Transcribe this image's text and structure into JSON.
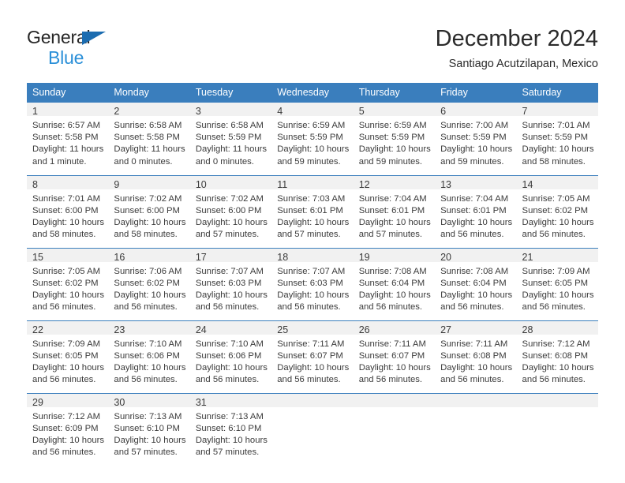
{
  "brand": {
    "word1": "General",
    "word2": "Blue",
    "triangle_color": "#1b6cb0",
    "word2_color": "#2a8fd8"
  },
  "header": {
    "title": "December 2024",
    "subtitle": "Santiago Acutzilapan, Mexico"
  },
  "theme": {
    "header_blue": "#3a7ebd",
    "daynum_band": "#f1f1f1",
    "text": "#3b3b3b"
  },
  "weekday_headers": [
    "Sunday",
    "Monday",
    "Tuesday",
    "Wednesday",
    "Thursday",
    "Friday",
    "Saturday"
  ],
  "weeks": [
    [
      {
        "day": "1",
        "sunrise": "Sunrise: 6:57 AM",
        "sunset": "Sunset: 5:58 PM",
        "daylight1": "Daylight: 11 hours",
        "daylight2": "and 1 minute."
      },
      {
        "day": "2",
        "sunrise": "Sunrise: 6:58 AM",
        "sunset": "Sunset: 5:58 PM",
        "daylight1": "Daylight: 11 hours",
        "daylight2": "and 0 minutes."
      },
      {
        "day": "3",
        "sunrise": "Sunrise: 6:58 AM",
        "sunset": "Sunset: 5:59 PM",
        "daylight1": "Daylight: 11 hours",
        "daylight2": "and 0 minutes."
      },
      {
        "day": "4",
        "sunrise": "Sunrise: 6:59 AM",
        "sunset": "Sunset: 5:59 PM",
        "daylight1": "Daylight: 10 hours",
        "daylight2": "and 59 minutes."
      },
      {
        "day": "5",
        "sunrise": "Sunrise: 6:59 AM",
        "sunset": "Sunset: 5:59 PM",
        "daylight1": "Daylight: 10 hours",
        "daylight2": "and 59 minutes."
      },
      {
        "day": "6",
        "sunrise": "Sunrise: 7:00 AM",
        "sunset": "Sunset: 5:59 PM",
        "daylight1": "Daylight: 10 hours",
        "daylight2": "and 59 minutes."
      },
      {
        "day": "7",
        "sunrise": "Sunrise: 7:01 AM",
        "sunset": "Sunset: 5:59 PM",
        "daylight1": "Daylight: 10 hours",
        "daylight2": "and 58 minutes."
      }
    ],
    [
      {
        "day": "8",
        "sunrise": "Sunrise: 7:01 AM",
        "sunset": "Sunset: 6:00 PM",
        "daylight1": "Daylight: 10 hours",
        "daylight2": "and 58 minutes."
      },
      {
        "day": "9",
        "sunrise": "Sunrise: 7:02 AM",
        "sunset": "Sunset: 6:00 PM",
        "daylight1": "Daylight: 10 hours",
        "daylight2": "and 58 minutes."
      },
      {
        "day": "10",
        "sunrise": "Sunrise: 7:02 AM",
        "sunset": "Sunset: 6:00 PM",
        "daylight1": "Daylight: 10 hours",
        "daylight2": "and 57 minutes."
      },
      {
        "day": "11",
        "sunrise": "Sunrise: 7:03 AM",
        "sunset": "Sunset: 6:01 PM",
        "daylight1": "Daylight: 10 hours",
        "daylight2": "and 57 minutes."
      },
      {
        "day": "12",
        "sunrise": "Sunrise: 7:04 AM",
        "sunset": "Sunset: 6:01 PM",
        "daylight1": "Daylight: 10 hours",
        "daylight2": "and 57 minutes."
      },
      {
        "day": "13",
        "sunrise": "Sunrise: 7:04 AM",
        "sunset": "Sunset: 6:01 PM",
        "daylight1": "Daylight: 10 hours",
        "daylight2": "and 56 minutes."
      },
      {
        "day": "14",
        "sunrise": "Sunrise: 7:05 AM",
        "sunset": "Sunset: 6:02 PM",
        "daylight1": "Daylight: 10 hours",
        "daylight2": "and 56 minutes."
      }
    ],
    [
      {
        "day": "15",
        "sunrise": "Sunrise: 7:05 AM",
        "sunset": "Sunset: 6:02 PM",
        "daylight1": "Daylight: 10 hours",
        "daylight2": "and 56 minutes."
      },
      {
        "day": "16",
        "sunrise": "Sunrise: 7:06 AM",
        "sunset": "Sunset: 6:02 PM",
        "daylight1": "Daylight: 10 hours",
        "daylight2": "and 56 minutes."
      },
      {
        "day": "17",
        "sunrise": "Sunrise: 7:07 AM",
        "sunset": "Sunset: 6:03 PM",
        "daylight1": "Daylight: 10 hours",
        "daylight2": "and 56 minutes."
      },
      {
        "day": "18",
        "sunrise": "Sunrise: 7:07 AM",
        "sunset": "Sunset: 6:03 PM",
        "daylight1": "Daylight: 10 hours",
        "daylight2": "and 56 minutes."
      },
      {
        "day": "19",
        "sunrise": "Sunrise: 7:08 AM",
        "sunset": "Sunset: 6:04 PM",
        "daylight1": "Daylight: 10 hours",
        "daylight2": "and 56 minutes."
      },
      {
        "day": "20",
        "sunrise": "Sunrise: 7:08 AM",
        "sunset": "Sunset: 6:04 PM",
        "daylight1": "Daylight: 10 hours",
        "daylight2": "and 56 minutes."
      },
      {
        "day": "21",
        "sunrise": "Sunrise: 7:09 AM",
        "sunset": "Sunset: 6:05 PM",
        "daylight1": "Daylight: 10 hours",
        "daylight2": "and 56 minutes."
      }
    ],
    [
      {
        "day": "22",
        "sunrise": "Sunrise: 7:09 AM",
        "sunset": "Sunset: 6:05 PM",
        "daylight1": "Daylight: 10 hours",
        "daylight2": "and 56 minutes."
      },
      {
        "day": "23",
        "sunrise": "Sunrise: 7:10 AM",
        "sunset": "Sunset: 6:06 PM",
        "daylight1": "Daylight: 10 hours",
        "daylight2": "and 56 minutes."
      },
      {
        "day": "24",
        "sunrise": "Sunrise: 7:10 AM",
        "sunset": "Sunset: 6:06 PM",
        "daylight1": "Daylight: 10 hours",
        "daylight2": "and 56 minutes."
      },
      {
        "day": "25",
        "sunrise": "Sunrise: 7:11 AM",
        "sunset": "Sunset: 6:07 PM",
        "daylight1": "Daylight: 10 hours",
        "daylight2": "and 56 minutes."
      },
      {
        "day": "26",
        "sunrise": "Sunrise: 7:11 AM",
        "sunset": "Sunset: 6:07 PM",
        "daylight1": "Daylight: 10 hours",
        "daylight2": "and 56 minutes."
      },
      {
        "day": "27",
        "sunrise": "Sunrise: 7:11 AM",
        "sunset": "Sunset: 6:08 PM",
        "daylight1": "Daylight: 10 hours",
        "daylight2": "and 56 minutes."
      },
      {
        "day": "28",
        "sunrise": "Sunrise: 7:12 AM",
        "sunset": "Sunset: 6:08 PM",
        "daylight1": "Daylight: 10 hours",
        "daylight2": "and 56 minutes."
      }
    ],
    [
      {
        "day": "29",
        "sunrise": "Sunrise: 7:12 AM",
        "sunset": "Sunset: 6:09 PM",
        "daylight1": "Daylight: 10 hours",
        "daylight2": "and 56 minutes."
      },
      {
        "day": "30",
        "sunrise": "Sunrise: 7:13 AM",
        "sunset": "Sunset: 6:10 PM",
        "daylight1": "Daylight: 10 hours",
        "daylight2": "and 57 minutes."
      },
      {
        "day": "31",
        "sunrise": "Sunrise: 7:13 AM",
        "sunset": "Sunset: 6:10 PM",
        "daylight1": "Daylight: 10 hours",
        "daylight2": "and 57 minutes."
      },
      {
        "day": "",
        "sunrise": "",
        "sunset": "",
        "daylight1": "",
        "daylight2": ""
      },
      {
        "day": "",
        "sunrise": "",
        "sunset": "",
        "daylight1": "",
        "daylight2": ""
      },
      {
        "day": "",
        "sunrise": "",
        "sunset": "",
        "daylight1": "",
        "daylight2": ""
      },
      {
        "day": "",
        "sunrise": "",
        "sunset": "",
        "daylight1": "",
        "daylight2": ""
      }
    ]
  ]
}
